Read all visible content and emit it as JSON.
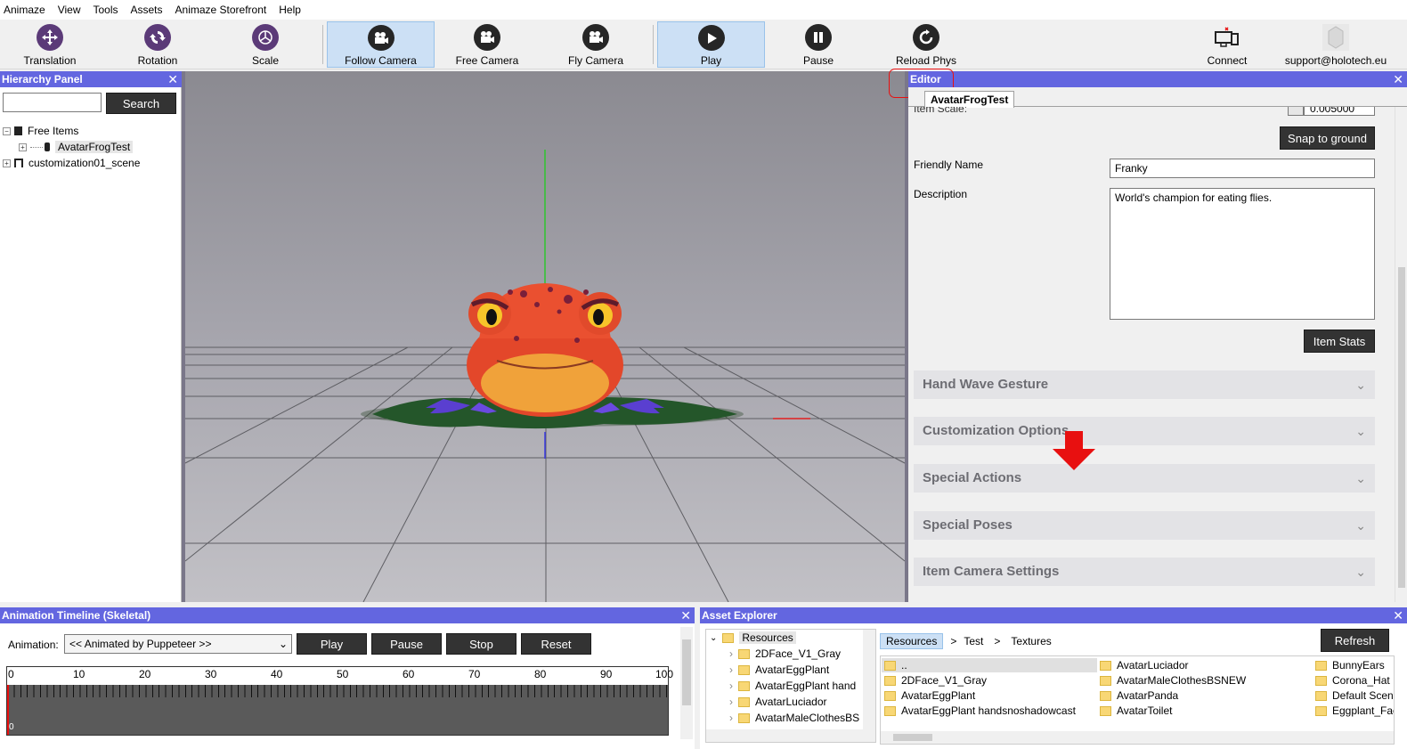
{
  "menu": [
    "Animaze",
    "View",
    "Tools",
    "Assets",
    "Animaze Storefront",
    "Help"
  ],
  "toolbar": {
    "translation": "Translation",
    "rotation": "Rotation",
    "scale": "Scale",
    "follow_camera": "Follow Camera",
    "free_camera": "Free Camera",
    "fly_camera": "Fly Camera",
    "play": "Play",
    "pause": "Pause",
    "reload_phys": "Reload Phys",
    "connect": "Connect",
    "support": "support@holotech.eu"
  },
  "hierarchy": {
    "title": "Hierarchy Panel",
    "search_button": "Search",
    "search_value": "",
    "items": [
      {
        "label": "Free Items",
        "toggle": "−"
      },
      {
        "label": "AvatarFrogTest",
        "toggle": "+"
      },
      {
        "label": "customization01_scene",
        "toggle": "+"
      }
    ]
  },
  "editor": {
    "title": "Editor",
    "tab": "AvatarFrogTest",
    "item_scale_label": "Item Scale:",
    "item_scale_value": "0.005000",
    "snap_button": "Snap to ground",
    "friendly_name_label": "Friendly Name",
    "friendly_name_value": "Franky",
    "description_label": "Description",
    "description_value": "World's champion for eating flies.",
    "item_stats_button": "Item Stats",
    "sections": [
      "Hand Wave Gesture",
      "Customization Options",
      "Special Actions",
      "Special Poses",
      "Item Camera Settings"
    ]
  },
  "timeline": {
    "title": "Animation Timeline (Skeletal)",
    "animation_label": "Animation:",
    "animation_value": "<< Animated by Puppeteer >>",
    "play": "Play",
    "pause": "Pause",
    "stop": "Stop",
    "reset": "Reset",
    "ticks": [
      "0",
      "10",
      "20",
      "30",
      "40",
      "50",
      "60",
      "70",
      "80",
      "90",
      "100"
    ]
  },
  "assets": {
    "title": "Asset Explorer",
    "tree_root": "Resources",
    "tree_items": [
      "2DFace_V1_Gray",
      "AvatarEggPlant",
      "AvatarEggPlant hand",
      "AvatarLuciador",
      "AvatarMaleClothesBS"
    ],
    "breadcrumb": [
      "Resources",
      "Test",
      "Textures"
    ],
    "breadcrumb_sep": ">",
    "refresh": "Refresh",
    "col1": [
      "..",
      "2DFace_V1_Gray",
      "AvatarEggPlant",
      "AvatarEggPlant handsnoshadowcast"
    ],
    "col2": [
      "AvatarLuciador",
      "AvatarMaleClothesBSNEW",
      "AvatarPanda",
      "AvatarToilet"
    ],
    "col3": [
      "BunnyEars",
      "Corona_Hat",
      "Default Scene",
      "Eggplant_Fac"
    ]
  },
  "colors": {
    "panel_header": "#6366e0",
    "accent_red": "#e81010",
    "button_dark": "#333333"
  }
}
